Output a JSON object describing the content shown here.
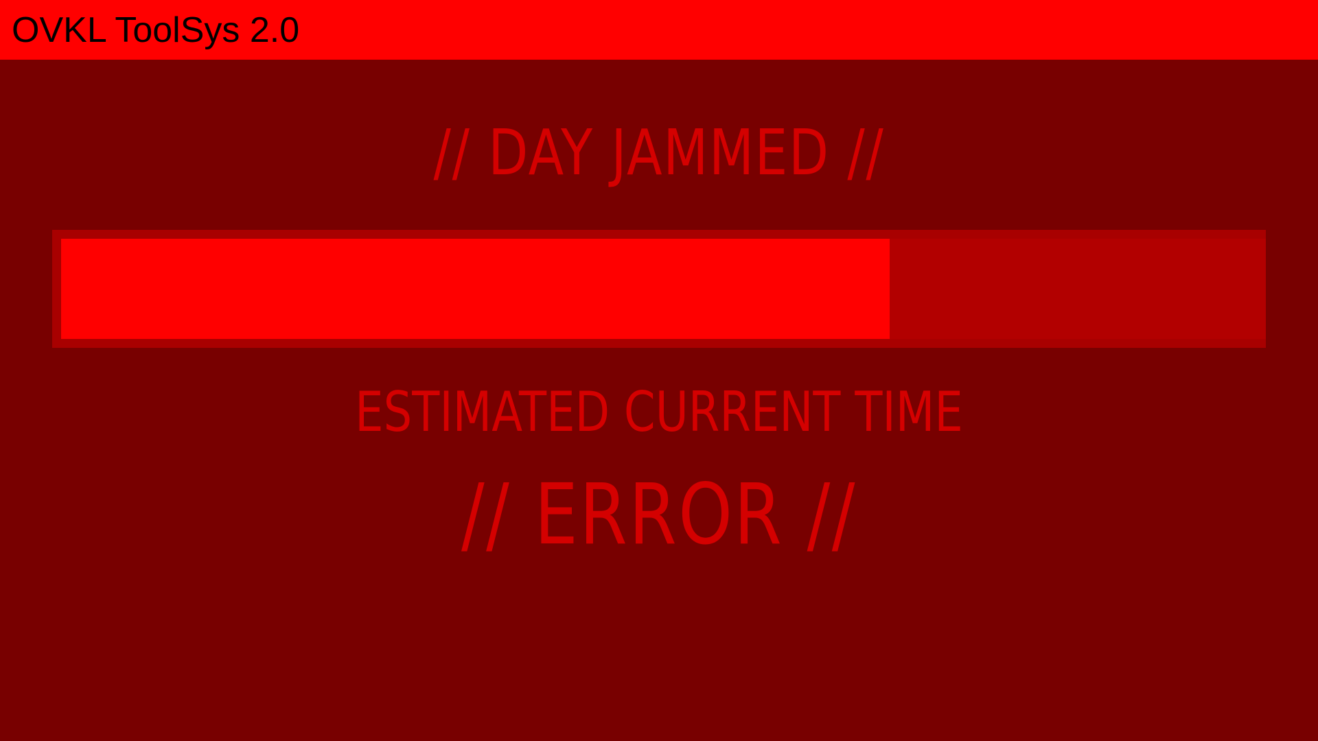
{
  "app": {
    "title": "OVKL ToolSys 2.0"
  },
  "status": {
    "heading": "// DAY JAMMED //"
  },
  "progress": {
    "fraction": 0.688
  },
  "time": {
    "label": "ESTIMATED CURRENT TIME",
    "value": "// ERROR //"
  },
  "colors": {
    "titlebar": "#ff0000",
    "background": "#780000",
    "text_accent": "#d40000",
    "progress_fill": "#ff0000",
    "progress_track": "#b20000"
  }
}
